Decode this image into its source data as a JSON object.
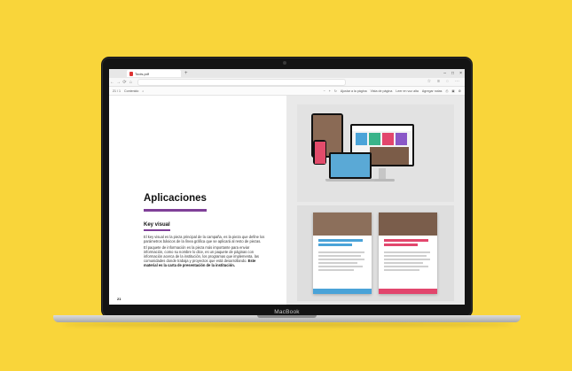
{
  "browser": {
    "tab_title": "Tools.pdf",
    "window_controls": [
      "–",
      "□",
      "×"
    ],
    "nav_buttons": [
      "←",
      "→",
      "⟳",
      "⌂"
    ],
    "url_text": "",
    "toolbar_right_icons": [
      "star-icon",
      "favorites-icon",
      "profile-icon",
      "more-icon"
    ]
  },
  "pdf_toolbar": {
    "page_indicator": "21 / 1",
    "contents_label": "Contenido",
    "items": [
      "Ajustar a la página",
      "Vista de página",
      "Leer en voz alta",
      "Agregar notas"
    ],
    "icons": [
      "search-icon",
      "zoom-out-icon",
      "zoom-in-icon",
      "rotate-icon",
      "fit-icon",
      "print-icon",
      "save-icon",
      "settings-icon"
    ]
  },
  "document": {
    "heading": "Aplicaciones",
    "subheading": "Key visual",
    "paragraph1": "El key visual es la pieza principal de la campaña, es la pieza que define los parámetros básicos de la línea gráfica que se aplicará al resto de piezas.",
    "paragraph2_regular": "El paquete de información es la pieza más importante para enviar información, como su nombre lo dice, es un paquete de páginas con información acerca de la institución, los programas que implementa, las comunidades donde trabaja y proyectos que está desarrollando.",
    "paragraph2_bold": "Este material es la carta de presentación de la institución.",
    "page_number": "21"
  },
  "device": {
    "bezel_label": "MacBook"
  },
  "colors": {
    "background": "#f9d53a",
    "accent_purple": "#7f3f98",
    "tile_blue": "#4aa3d8",
    "tile_pink": "#e2466d",
    "tile_green": "#39b38a",
    "tile_purple": "#8a58c7"
  }
}
